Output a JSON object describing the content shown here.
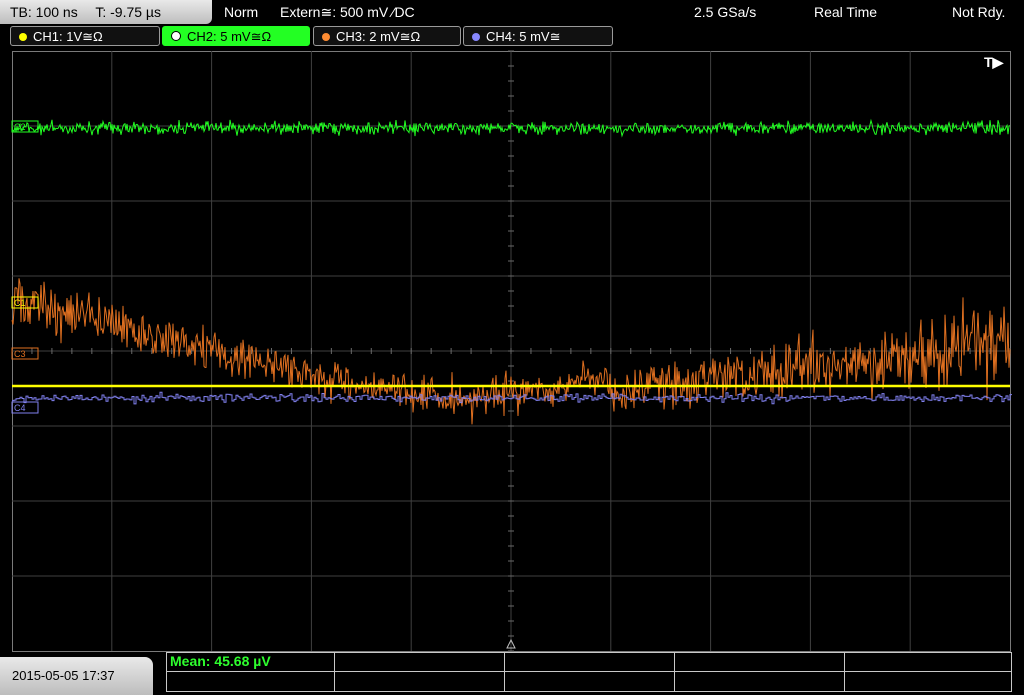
{
  "status": {
    "timebase": "TB: 100 ns",
    "trigger_time": "T: -9.75 µs",
    "mode": "Norm",
    "trigger_source": "Extern≅: 500 mV ⁄DC",
    "sample_rate": "2.5 GSa/s",
    "acq_mode": "Real Time",
    "state": "Not Rdy."
  },
  "channels": [
    {
      "label": "CH1: 1V≅Ω",
      "color": "#ffff00",
      "active": false
    },
    {
      "label": "CH2: 5 mV≅Ω",
      "color": "#22ff22",
      "active": true
    },
    {
      "label": "CH3: 2 mV≅Ω",
      "color": "#ff8c32",
      "active": false
    },
    {
      "label": "CH4: 5 mV≅",
      "color": "#8888ff",
      "active": false
    }
  ],
  "trigger_marker": "T▶",
  "markers": {
    "c1": "C1",
    "c2": "C2",
    "c3": "C3",
    "c4": "C4"
  },
  "datetime": "2015-05-05 17:37",
  "measurement": "Mean: 45.68 µV",
  "colors": {
    "grid": "#404040",
    "ch1": "#ffff00",
    "ch2": "#22ff22",
    "ch3": "#e07020",
    "ch4": "#8080ee"
  }
}
